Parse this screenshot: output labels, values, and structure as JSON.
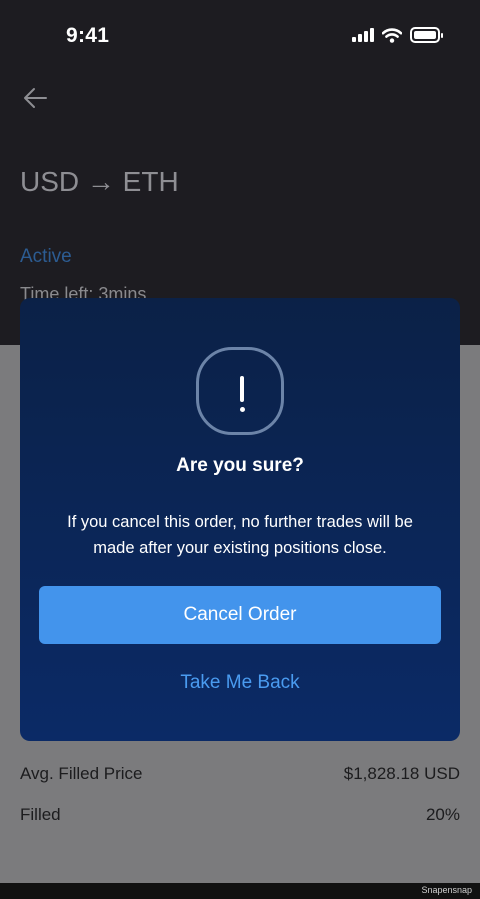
{
  "status_bar": {
    "time": "9:41"
  },
  "header": {
    "title": "USD → ETH"
  },
  "order": {
    "status": "Active",
    "time_left": "Time left: 3mins"
  },
  "details": [
    {
      "label": "Avg. Filled Price",
      "value": "$1,828.18 USD"
    },
    {
      "label": "Filled",
      "value": "20%"
    }
  ],
  "dialog": {
    "title": "Are you sure?",
    "message": "If you cancel this order, no further trades will be made after your existing positions close.",
    "primary_label": "Cancel Order",
    "secondary_label": "Take Me Back"
  },
  "watermark": "Snapensnap",
  "colors": {
    "primary_button": "#4394ec",
    "link": "#4a9bf0",
    "dialog_bg": "#0b2658",
    "active_status": "#2c5c92"
  },
  "icons": [
    "signal-icon",
    "wifi-icon",
    "battery-icon",
    "back-arrow-icon",
    "alert-icon"
  ]
}
